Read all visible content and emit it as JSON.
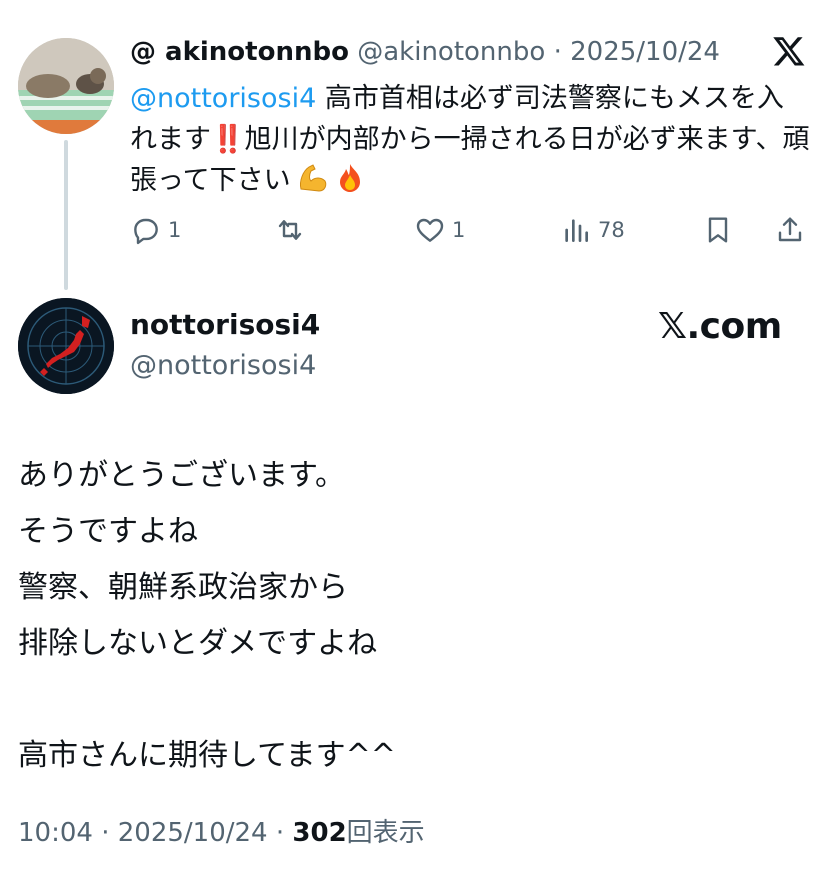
{
  "reply_tweet": {
    "display_name": "@ akinotonnbo",
    "handle": "@akinotonnbo",
    "separator": "·",
    "date": "2025/10/24",
    "mention": "@nottorisosi4",
    "text_1": " 高市首相は必ず司法警察にもメスを入れます",
    "exclaim": "‼️",
    "text_2": "旭川が内部から一掃される日が必ず来ます、頑張って下さい",
    "emoji_1": "muscle-emoji",
    "emoji_2": "fire-emoji",
    "actions": {
      "replies": "1",
      "likes": "1",
      "views": "78"
    }
  },
  "main_tweet": {
    "display_name": "nottorisosi4",
    "handle": "@nottorisosi4",
    "source": "𝕏.com",
    "lines": [
      "ありがとうございます。",
      "そうですよね",
      "警察、朝鮮系政治家から",
      "排除しないとダメですよね",
      "",
      "高市さんに期待してます^^"
    ],
    "time": "10:04",
    "separator": "·",
    "date": "2025/10/24",
    "views_count": "302",
    "views_label": "回表示"
  },
  "colors": {
    "link": "#1d9bf0",
    "text": "#0f1419",
    "muted": "#536471",
    "thread_line": "#cfd9de"
  }
}
